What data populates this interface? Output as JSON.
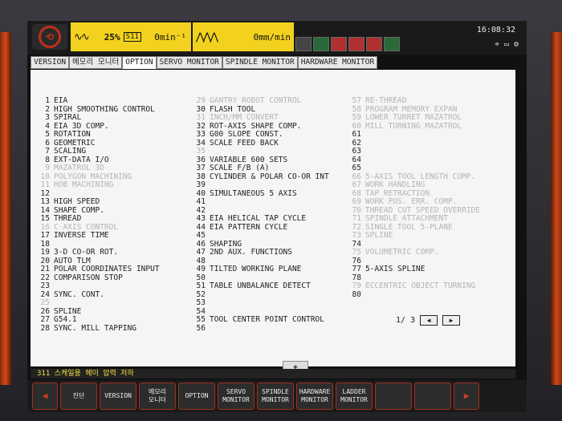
{
  "topbar": {
    "feed_override": "25%",
    "sl_label": "S11",
    "spindle_unit": "0min⁻¹",
    "feed_unit": "0mm/min",
    "clock": "16:08:32"
  },
  "tabs": [
    {
      "label": "VERSION"
    },
    {
      "label": "메모리 모니터"
    },
    {
      "label": "OPTION"
    },
    {
      "label": "SERVO MONITOR"
    },
    {
      "label": "SPINDLE MONITOR"
    },
    {
      "label": "HARDWARE MONITOR"
    }
  ],
  "options": {
    "col1": [
      {
        "n": "1",
        "t": "EIA",
        "dim": false
      },
      {
        "n": "2",
        "t": "HIGH SMOOTHING CONTROL",
        "dim": false
      },
      {
        "n": "3",
        "t": "SPIRAL",
        "dim": false
      },
      {
        "n": "4",
        "t": "EIA 3D COMP.",
        "dim": false
      },
      {
        "n": "5",
        "t": "ROTATION",
        "dim": false
      },
      {
        "n": "6",
        "t": "GEOMETRIC",
        "dim": false
      },
      {
        "n": "7",
        "t": "SCALING",
        "dim": false
      },
      {
        "n": "8",
        "t": "EXT-DATA I/O",
        "dim": false
      },
      {
        "n": "9",
        "t": "MAZATROL 3D",
        "dim": true
      },
      {
        "n": "10",
        "t": "POLYGON MACHINING",
        "dim": true
      },
      {
        "n": "11",
        "t": "HOB MACHINING",
        "dim": true
      },
      {
        "n": "12",
        "t": "",
        "dim": false
      },
      {
        "n": "13",
        "t": "HIGH SPEED",
        "dim": false
      },
      {
        "n": "14",
        "t": "SHAPE COMP.",
        "dim": false
      },
      {
        "n": "15",
        "t": "THREAD",
        "dim": false
      },
      {
        "n": "16",
        "t": "C-AXIS CONTROL",
        "dim": true
      },
      {
        "n": "17",
        "t": "INVERSE TIME",
        "dim": false
      },
      {
        "n": "18",
        "t": "",
        "dim": false
      },
      {
        "n": "19",
        "t": "3-D CO-OR ROT.",
        "dim": false
      },
      {
        "n": "20",
        "t": "AUTO TLM",
        "dim": false
      },
      {
        "n": "21",
        "t": "POLAR COORDINATES INPUT",
        "dim": false
      },
      {
        "n": "22",
        "t": "COMPARISON STOP",
        "dim": false
      },
      {
        "n": "23",
        "t": "",
        "dim": false
      },
      {
        "n": "24",
        "t": "SYNC. CONT.",
        "dim": false
      },
      {
        "n": "25",
        "t": "",
        "dim": true
      },
      {
        "n": "26",
        "t": "SPLINE",
        "dim": false
      },
      {
        "n": "27",
        "t": "G54.1",
        "dim": false
      },
      {
        "n": "28",
        "t": "SYNC. MILL TAPPING",
        "dim": false
      }
    ],
    "col2": [
      {
        "n": "29",
        "t": "GANTRY ROBOT CONTROL",
        "dim": true
      },
      {
        "n": "30",
        "t": "FLASH TOOL",
        "dim": false
      },
      {
        "n": "31",
        "t": "INCH/MM CONVERT",
        "dim": true
      },
      {
        "n": "32",
        "t": "ROT-AXIS SHAPE COMP.",
        "dim": false
      },
      {
        "n": "33",
        "t": "G00 SLOPE CONST.",
        "dim": false
      },
      {
        "n": "34",
        "t": "SCALE FEED BACK",
        "dim": false
      },
      {
        "n": "35",
        "t": "",
        "dim": true
      },
      {
        "n": "36",
        "t": "VARIABLE 600 SETS",
        "dim": false
      },
      {
        "n": "37",
        "t": "SCALE F/B (A)",
        "dim": false
      },
      {
        "n": "38",
        "t": "CYLINDER & POLAR CO-OR INT",
        "dim": false
      },
      {
        "n": "39",
        "t": "",
        "dim": false
      },
      {
        "n": "40",
        "t": "SIMULTANEOUS 5 AXIS",
        "dim": false
      },
      {
        "n": "41",
        "t": "",
        "dim": false
      },
      {
        "n": "42",
        "t": "",
        "dim": false
      },
      {
        "n": "43",
        "t": "EIA HELICAL TAP CYCLE",
        "dim": false
      },
      {
        "n": "44",
        "t": "EIA PATTERN CYCLE",
        "dim": false
      },
      {
        "n": "45",
        "t": "",
        "dim": false
      },
      {
        "n": "46",
        "t": "SHAPING",
        "dim": false
      },
      {
        "n": "47",
        "t": "2ND AUX. FUNCTIONS",
        "dim": false
      },
      {
        "n": "48",
        "t": "",
        "dim": false
      },
      {
        "n": "49",
        "t": "TILTED WORKING PLANE",
        "dim": false
      },
      {
        "n": "50",
        "t": "",
        "dim": false
      },
      {
        "n": "51",
        "t": "TABLE UNBALANCE DETECT",
        "dim": false
      },
      {
        "n": "52",
        "t": "",
        "dim": false
      },
      {
        "n": "53",
        "t": "",
        "dim": false
      },
      {
        "n": "54",
        "t": "",
        "dim": false
      },
      {
        "n": "55",
        "t": "TOOL CENTER POINT CONTROL",
        "dim": false
      },
      {
        "n": "56",
        "t": "",
        "dim": false
      }
    ],
    "col3": [
      {
        "n": "57",
        "t": "RE-THREAD",
        "dim": true
      },
      {
        "n": "58",
        "t": "PROGRAM MEMORY EXPAN",
        "dim": true
      },
      {
        "n": "59",
        "t": "LOWER TURRET MAZATROL",
        "dim": true
      },
      {
        "n": "60",
        "t": "MILL TURNING MAZATROL",
        "dim": true
      },
      {
        "n": "61",
        "t": "",
        "dim": false
      },
      {
        "n": "62",
        "t": "",
        "dim": false
      },
      {
        "n": "63",
        "t": "",
        "dim": false
      },
      {
        "n": "64",
        "t": "",
        "dim": false
      },
      {
        "n": "65",
        "t": "",
        "dim": false
      },
      {
        "n": "66",
        "t": "5-AXIS TOOL LENGTH COMP.",
        "dim": true
      },
      {
        "n": "67",
        "t": "WORK HANDLING",
        "dim": true
      },
      {
        "n": "68",
        "t": "TAP RETRACTION",
        "dim": true
      },
      {
        "n": "69",
        "t": "WORK POS. ERR. COMP.",
        "dim": true
      },
      {
        "n": "70",
        "t": "THREAD CUT SPEED OVERRIDE",
        "dim": true
      },
      {
        "n": "71",
        "t": "SPINDLE ATTACHMENT",
        "dim": true
      },
      {
        "n": "72",
        "t": "SINGLE TOOL 5-PLANE",
        "dim": true
      },
      {
        "n": "73",
        "t": "SPLINE",
        "dim": true
      },
      {
        "n": "74",
        "t": "",
        "dim": false
      },
      {
        "n": "75",
        "t": "VOLUMETRIC COMP.",
        "dim": true
      },
      {
        "n": "76",
        "t": "",
        "dim": false
      },
      {
        "n": "77",
        "t": "5-AXIS SPLINE",
        "dim": false
      },
      {
        "n": "78",
        "t": "",
        "dim": false
      },
      {
        "n": "79",
        "t": "ECCENTRIC OBJECT TURNING",
        "dim": true
      },
      {
        "n": "80",
        "t": "",
        "dim": false
      }
    ]
  },
  "pager": {
    "current": "1/",
    "total": "3",
    "prev": "◀",
    "next": "▶"
  },
  "status_message": "311 스케일용 헤이 압력 저하",
  "softkeys": [
    {
      "label": "◀"
    },
    {
      "label": "진단"
    },
    {
      "label": "VERSION"
    },
    {
      "label": "메모리\n모니터"
    },
    {
      "label": "OPTION"
    },
    {
      "label": "SERVO\nMONITOR"
    },
    {
      "label": "SPINDLE\nMONITOR"
    },
    {
      "label": "HARDWARE\nMONITOR"
    },
    {
      "label": "LADDER\nMONITOR"
    },
    {
      "label": ""
    },
    {
      "label": ""
    },
    {
      "label": "▶"
    }
  ]
}
